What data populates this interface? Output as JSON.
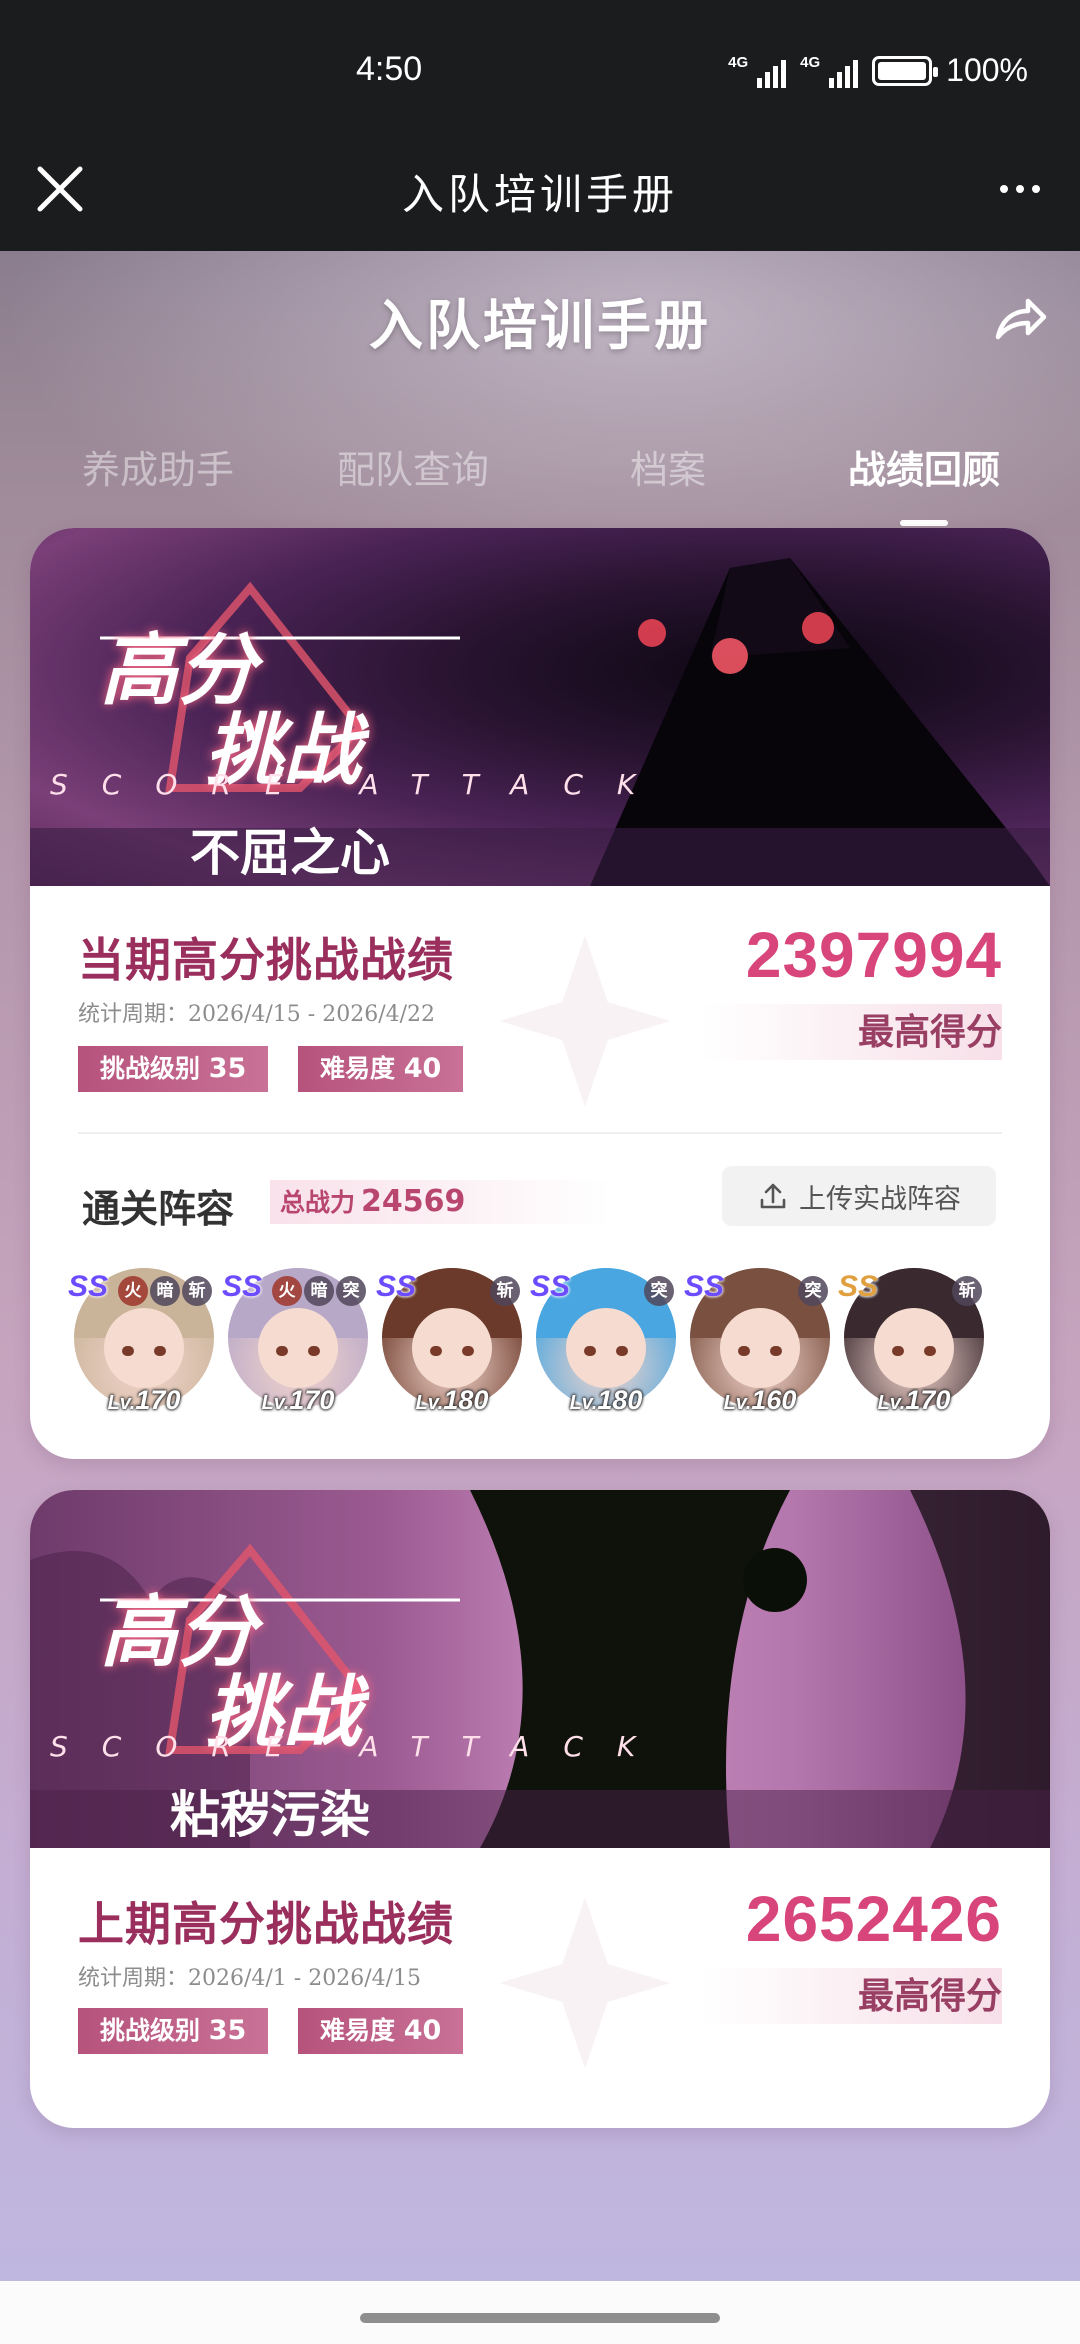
{
  "status_bar": {
    "time": "4:50",
    "net1": "4G",
    "net2": "4G",
    "battery_percent": "100%",
    "battery_level": 1.0
  },
  "app_bar": {
    "title": "入队培训手册",
    "close_icon": "close-icon",
    "more_icon": "more-icon"
  },
  "page": {
    "title": "入队培训手册",
    "share_icon": "share-icon",
    "tabs": [
      {
        "label": "养成助手",
        "active": false
      },
      {
        "label": "配队查询",
        "active": false
      },
      {
        "label": "档案",
        "active": false
      },
      {
        "label": "战绩回顾",
        "active": true
      }
    ]
  },
  "current": {
    "banner": {
      "title_line1": "高分",
      "title_line2": "挑战",
      "subtitle_en": "SCORE ATTACK",
      "boss_name": "不屈之心"
    },
    "section_title": "当期高分挑战战绩",
    "period": "统计周期：2026/4/15 - 2026/4/22",
    "challenge_level": {
      "label": "挑战级别",
      "value": "35"
    },
    "difficulty": {
      "label": "难易度",
      "value": "40"
    },
    "score": "2397994",
    "score_label": "最高得分",
    "team": {
      "title": "通关阵容",
      "power_label": "总战力",
      "power_value": "24569",
      "upload_label": "上传实战阵容",
      "upload_icon": "upload-icon",
      "heroes": [
        {
          "rank": "SS",
          "badges": [
            "火",
            "暗",
            "斩"
          ],
          "level_prefix": "Lv.",
          "level": "170",
          "hair": "#c9b49a"
        },
        {
          "rank": "SS",
          "badges": [
            "火",
            "暗",
            "突"
          ],
          "level_prefix": "Lv.",
          "level": "170",
          "hair": "#b8a8c8"
        },
        {
          "rank": "SS",
          "badges": [
            "斩"
          ],
          "level_prefix": "Lv.",
          "level": "180",
          "hair": "#6b3a2a"
        },
        {
          "rank": "SS",
          "badges": [
            "突"
          ],
          "level_prefix": "Lv.",
          "level": "180",
          "hair": "#4aa6e0"
        },
        {
          "rank": "SS",
          "badges": [
            "突"
          ],
          "level_prefix": "Lv.",
          "level": "160",
          "hair": "#7a5040"
        },
        {
          "rank": "SS",
          "badges": [
            "斩"
          ],
          "level_prefix": "Lv.",
          "level": "170",
          "hair": "#3a2a30",
          "gold": true
        }
      ]
    }
  },
  "previous": {
    "banner": {
      "title_line1": "高分",
      "title_line2": "挑战",
      "subtitle_en": "SCORE ATTACK",
      "boss_name": "粘秽污染"
    },
    "section_title": "上期高分挑战战绩",
    "period": "统计周期：2026/4/1 - 2026/4/15",
    "challenge_level": {
      "label": "挑战级别",
      "value": "35"
    },
    "difficulty": {
      "label": "难易度",
      "value": "40"
    },
    "score": "2652426",
    "score_label": "最高得分"
  },
  "colors": {
    "accent": "#d8457a",
    "title": "#9a2f5e",
    "chip": "#b6537c"
  }
}
